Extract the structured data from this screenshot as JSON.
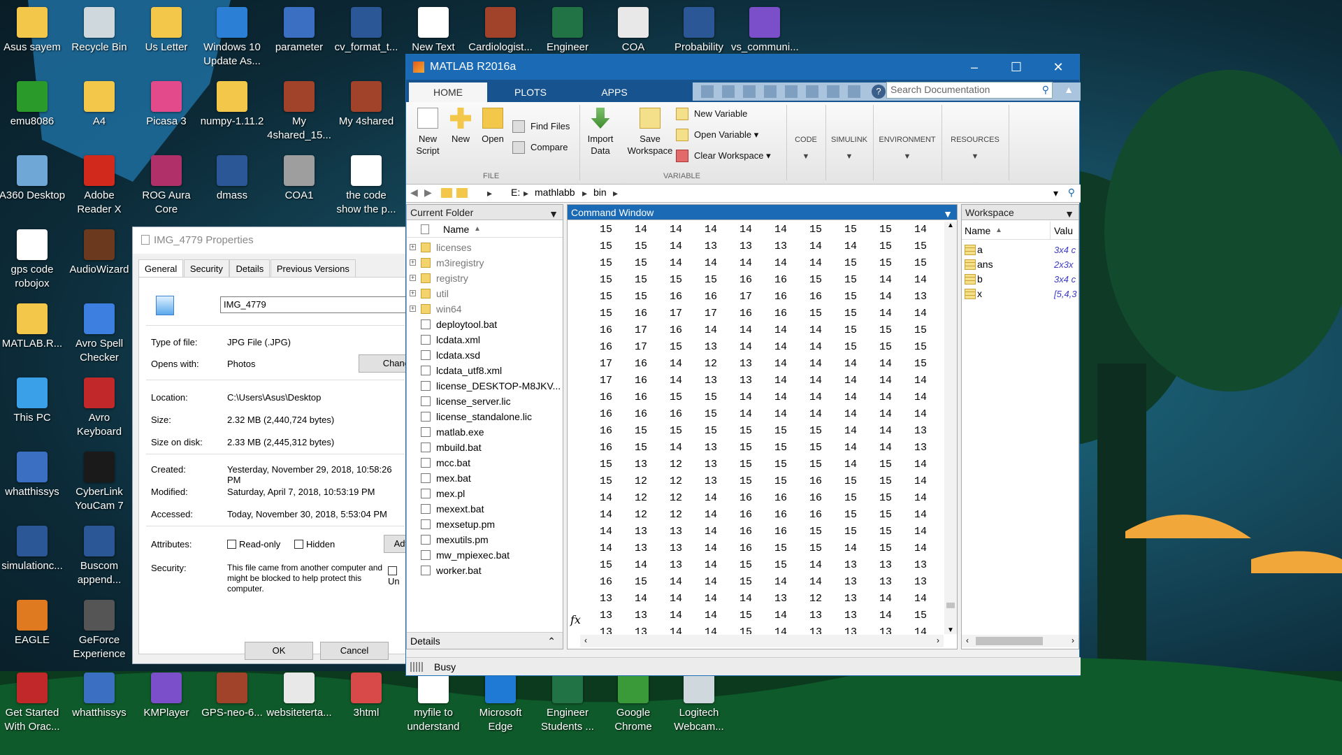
{
  "desktop": {
    "icons": [
      {
        "label": "Asus sayem",
        "icon": "folder-icon",
        "color": "#f3c84a"
      },
      {
        "label": "Recycle Bin",
        "icon": "recycle-bin-icon",
        "color": "#cfd8dc"
      },
      {
        "label": "Us Letter",
        "icon": "folder-icon",
        "color": "#f3c84a"
      },
      {
        "label": "Windows 10 Update As...",
        "icon": "windows-update-icon",
        "color": "#2b7fd4"
      },
      {
        "label": "parameter",
        "icon": "cpp-file-icon",
        "color": "#3a6fc2"
      },
      {
        "label": "cv_format_t...",
        "icon": "word-doc-icon",
        "color": "#2b5797"
      },
      {
        "label": "New Text",
        "icon": "text-file-icon",
        "color": "#ffffff"
      },
      {
        "label": "Cardiologist...",
        "icon": "winrar-icon",
        "color": "#a0432a"
      },
      {
        "label": "Engineer",
        "icon": "excel-icon",
        "color": "#217346"
      },
      {
        "label": "COA",
        "icon": "file-icon",
        "color": "#e8e8e8"
      },
      {
        "label": "Probability",
        "icon": "word-doc-icon",
        "color": "#2b5797"
      },
      {
        "label": "vs_communi...",
        "icon": "visual-studio-icon",
        "color": "#7a4fc9"
      },
      {
        "label": "emu8086",
        "icon": "emu8086-icon",
        "color": "#2a9a2a"
      },
      {
        "label": "A4",
        "icon": "folder-icon",
        "color": "#f3c84a"
      },
      {
        "label": "Picasa 3",
        "icon": "picasa-icon",
        "color": "#e24a8c"
      },
      {
        "label": "numpy-1.11.2",
        "icon": "folder-icon",
        "color": "#f3c84a"
      },
      {
        "label": "My 4shared_15...",
        "icon": "winrar-icon",
        "color": "#a0432a"
      },
      {
        "label": "My 4shared",
        "icon": "winrar-icon",
        "color": "#a0432a"
      },
      {
        "label": "A360 Desktop",
        "icon": "a360-icon",
        "color": "#6fa8d6"
      },
      {
        "label": "Adobe Reader X",
        "icon": "adobe-reader-icon",
        "color": "#d12a1c"
      },
      {
        "label": "ROG Aura Core",
        "icon": "rog-aura-icon",
        "color": "#b0306a"
      },
      {
        "label": "dmass",
        "icon": "word-doc-icon",
        "color": "#2b5797"
      },
      {
        "label": "COA1",
        "icon": "file-icon",
        "color": "#9e9e9e"
      },
      {
        "label": "the code show the p...",
        "icon": "text-file-icon",
        "color": "#ffffff"
      },
      {
        "label": "gps code robojox",
        "icon": "text-file-icon",
        "color": "#ffffff"
      },
      {
        "label": "AudioWizard",
        "icon": "audiowizard-icon",
        "color": "#6b3a1e"
      },
      {
        "label": "MATLAB.R...",
        "icon": "folder-icon",
        "color": "#f3c84a"
      },
      {
        "label": "Avro Spell Checker",
        "icon": "avro-spell-icon",
        "color": "#3d7fe0"
      },
      {
        "label": "This PC",
        "icon": "this-pc-icon",
        "color": "#3aa0e8"
      },
      {
        "label": "Avro Keyboard",
        "icon": "avro-keyboard-icon",
        "color": "#c0282a"
      },
      {
        "label": "whatthissys",
        "icon": "cpp-file-icon",
        "color": "#3a6fc2"
      },
      {
        "label": "CyberLink YouCam 7",
        "icon": "youcam-icon",
        "color": "#1a1a1a"
      },
      {
        "label": "simulationc...",
        "icon": "word-doc-icon",
        "color": "#2b5797"
      },
      {
        "label": "Buscom append...",
        "icon": "word-doc-icon",
        "color": "#2b5797"
      },
      {
        "label": "EAGLE",
        "icon": "eagle-icon",
        "color": "#e07a20"
      },
      {
        "label": "GeForce Experience",
        "icon": "geforce-icon",
        "color": "#555555"
      },
      {
        "label": "Get Started With Orac...",
        "icon": "oracle-icon",
        "color": "#c0282a"
      },
      {
        "label": "whatthissys",
        "icon": "c-file-icon",
        "color": "#3a6fc2"
      },
      {
        "label": "KMPlayer",
        "icon": "visual-studio-icon",
        "color": "#7a4fc9"
      },
      {
        "label": "GPS-neo-6...",
        "icon": "winrar-icon",
        "color": "#a0432a"
      },
      {
        "label": "websiteterta...",
        "icon": "spreadsheet-icon",
        "color": "#e8e8e8"
      },
      {
        "label": "3html",
        "icon": "html-file-icon",
        "color": "#d84a4a"
      },
      {
        "label": "myfile to understand",
        "icon": "text-file-icon",
        "color": "#ffffff"
      },
      {
        "label": "Microsoft Edge",
        "icon": "edge-icon",
        "color": "#1f7ad6"
      },
      {
        "label": "Engineer Students ...",
        "icon": "excel-icon",
        "color": "#217346"
      },
      {
        "label": "Google Chrome",
        "icon": "chrome-icon",
        "color": "#3a9a3a"
      },
      {
        "label": "Logitech Webcam...",
        "icon": "webcam-icon",
        "color": "#cfd8dc"
      }
    ]
  },
  "props": {
    "title": "IMG_4779 Properties",
    "tabs": [
      "General",
      "Security",
      "Details",
      "Previous Versions"
    ],
    "filename": "IMG_4779",
    "type_label": "Type of file:",
    "type_value": "JPG File (.JPG)",
    "opens_label": "Opens with:",
    "opens_value": "Photos",
    "change_btn": "Chang",
    "location_label": "Location:",
    "location_value": "C:\\Users\\Asus\\Desktop",
    "size_label": "Size:",
    "size_value": "2.32 MB (2,440,724 bytes)",
    "sod_label": "Size on disk:",
    "sod_value": "2.33 MB (2,445,312 bytes)",
    "created_label": "Created:",
    "created_value": "Yesterday, November 29, 2018, 10:58:26 PM",
    "modified_label": "Modified:",
    "modified_value": "Saturday, April 7, 2018, 10:53:19 PM",
    "accessed_label": "Accessed:",
    "accessed_value": "Today, November 30, 2018, 5:53:04 PM",
    "attr_label": "Attributes:",
    "readonly": "Read-only",
    "hidden": "Hidden",
    "advanced_btn": "Adv",
    "security_label": "Security:",
    "security_text": "This file came from another computer and might be blocked to help protect this computer.",
    "unblock": "Un",
    "ok": "OK",
    "cancel": "Cancel"
  },
  "matlab": {
    "title": "MATLAB R2016a",
    "tabs": [
      "HOME",
      "PLOTS",
      "APPS"
    ],
    "search_placeholder": "Search Documentation",
    "ribbon": {
      "new_script": "New Script",
      "new": "New",
      "open": "Open",
      "find_files": "Find Files",
      "compare": "Compare",
      "file_group": "FILE",
      "import_data": "Import Data",
      "save_workspace": "Save Workspace",
      "new_variable": "New Variable",
      "open_variable": "Open Variable",
      "clear_workspace": "Clear Workspace",
      "variable_group": "VARIABLE",
      "code": "CODE",
      "simulink": "SIMULINK",
      "environment": "ENVIRONMENT",
      "resources": "RESOURCES"
    },
    "path": [
      "E:",
      "mathlabb",
      "bin"
    ],
    "current_folder": {
      "title": "Current Folder",
      "name_col": "Name",
      "items": [
        {
          "name": "licenses",
          "folder": true
        },
        {
          "name": "m3iregistry",
          "folder": true
        },
        {
          "name": "registry",
          "folder": true
        },
        {
          "name": "util",
          "folder": true
        },
        {
          "name": "win64",
          "folder": true
        },
        {
          "name": "deploytool.bat",
          "folder": false
        },
        {
          "name": "lcdata.xml",
          "folder": false
        },
        {
          "name": "lcdata.xsd",
          "folder": false
        },
        {
          "name": "lcdata_utf8.xml",
          "folder": false
        },
        {
          "name": "license_DESKTOP-M8JKV...",
          "folder": false
        },
        {
          "name": "license_server.lic",
          "folder": false
        },
        {
          "name": "license_standalone.lic",
          "folder": false
        },
        {
          "name": "matlab.exe",
          "folder": false
        },
        {
          "name": "mbuild.bat",
          "folder": false
        },
        {
          "name": "mcc.bat",
          "folder": false
        },
        {
          "name": "mex.bat",
          "folder": false
        },
        {
          "name": "mex.pl",
          "folder": false
        },
        {
          "name": "mexext.bat",
          "folder": false
        },
        {
          "name": "mexsetup.pm",
          "folder": false
        },
        {
          "name": "mexutils.pm",
          "folder": false
        },
        {
          "name": "mw_mpiexec.bat",
          "folder": false
        },
        {
          "name": "worker.bat",
          "folder": false
        }
      ],
      "details": "Details"
    },
    "command_window": {
      "title": "Command Window",
      "fx": "fx",
      "rows": [
        [
          15,
          14,
          14,
          14,
          14,
          14,
          15,
          15,
          15,
          14
        ],
        [
          15,
          15,
          14,
          13,
          13,
          13,
          14,
          14,
          15,
          15
        ],
        [
          15,
          15,
          14,
          14,
          14,
          14,
          14,
          15,
          15,
          15
        ],
        [
          15,
          15,
          15,
          15,
          16,
          16,
          15,
          15,
          14,
          14
        ],
        [
          15,
          15,
          16,
          16,
          17,
          16,
          16,
          15,
          14,
          13
        ],
        [
          15,
          16,
          17,
          17,
          16,
          16,
          15,
          15,
          14,
          14
        ],
        [
          16,
          17,
          16,
          14,
          14,
          14,
          14,
          15,
          15,
          15
        ],
        [
          16,
          17,
          15,
          13,
          14,
          14,
          14,
          15,
          15,
          15
        ],
        [
          17,
          16,
          14,
          12,
          13,
          14,
          14,
          14,
          14,
          15
        ],
        [
          17,
          16,
          14,
          13,
          13,
          14,
          14,
          14,
          14,
          14
        ],
        [
          16,
          16,
          15,
          15,
          14,
          14,
          14,
          14,
          14,
          14
        ],
        [
          16,
          16,
          16,
          15,
          14,
          14,
          14,
          14,
          14,
          14
        ],
        [
          16,
          15,
          15,
          15,
          15,
          15,
          15,
          14,
          14,
          13
        ],
        [
          16,
          15,
          14,
          13,
          15,
          15,
          15,
          14,
          14,
          13
        ],
        [
          15,
          13,
          12,
          13,
          15,
          15,
          15,
          14,
          15,
          14
        ],
        [
          15,
          12,
          12,
          13,
          15,
          15,
          16,
          15,
          15,
          14
        ],
        [
          14,
          12,
          12,
          14,
          16,
          16,
          16,
          15,
          15,
          14
        ],
        [
          14,
          12,
          12,
          14,
          16,
          16,
          16,
          15,
          15,
          14
        ],
        [
          14,
          13,
          13,
          14,
          16,
          16,
          15,
          15,
          15,
          14
        ],
        [
          14,
          13,
          13,
          14,
          16,
          15,
          15,
          14,
          15,
          14
        ],
        [
          15,
          14,
          13,
          14,
          15,
          15,
          14,
          13,
          13,
          13
        ],
        [
          16,
          15,
          14,
          14,
          15,
          14,
          14,
          13,
          13,
          13
        ],
        [
          13,
          14,
          14,
          14,
          14,
          13,
          12,
          13,
          14,
          14
        ],
        [
          13,
          13,
          14,
          14,
          15,
          14,
          13,
          13,
          14,
          15
        ],
        [
          13,
          13,
          14,
          14,
          15,
          14,
          13,
          13,
          13,
          14
        ]
      ]
    },
    "workspace": {
      "title": "Workspace",
      "name_col": "Name",
      "value_col": "Valu",
      "vars": [
        {
          "name": "a",
          "value": "3x4 c"
        },
        {
          "name": "ans",
          "value": "2x3x"
        },
        {
          "name": "b",
          "value": "3x4 c"
        },
        {
          "name": "x",
          "value": "[5,4,3"
        }
      ]
    },
    "status": "Busy"
  }
}
